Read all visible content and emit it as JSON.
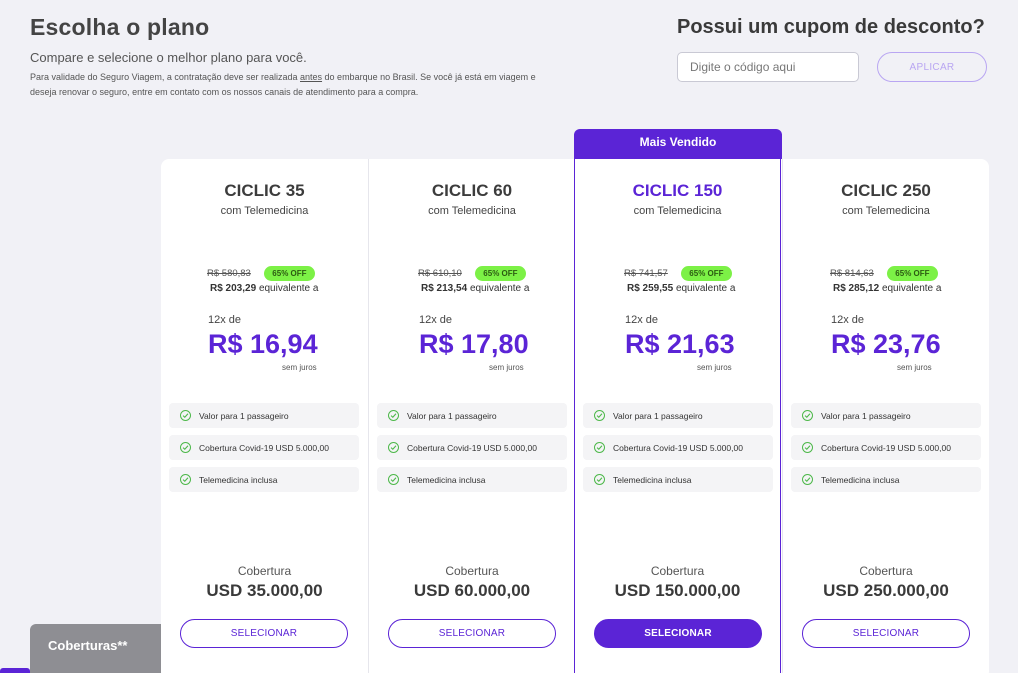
{
  "header": {
    "title": "Escolha o plano",
    "subtitle": "Compare e selecione o melhor plano para você.",
    "note_before": "Para validade do Seguro Viagem, a contratação deve ser realizada ",
    "note_emphasis": "antes",
    "note_after": " do embarque no Brasil. Se você já está em viagem e deseja renovar o seguro, entre em contato com os nossos canais de atendimento para a compra."
  },
  "coupon": {
    "title": "Possui um cupom de desconto?",
    "placeholder": "Digite o código aqui",
    "value": "",
    "apply_label": "APLICAR"
  },
  "featured_tag": "Mais Vendido",
  "plans": [
    {
      "name": "CICLIC 35",
      "subtitle": "com Telemedicina",
      "old_price": "R$ 580,83",
      "discount": "65% OFF",
      "total_price": "R$ 203,29",
      "equiv_text": "equivalente a",
      "installments": "12x de",
      "installment_price": "R$ 16,94",
      "interest": "sem juros",
      "features": [
        "Valor para 1 passageiro",
        "Cobertura Covid-19 USD 5.000,00",
        "Telemedicina inclusa"
      ],
      "coverage_label": "Cobertura",
      "coverage_value": "USD 35.000,00",
      "select_label": "SELECIONAR",
      "featured": false
    },
    {
      "name": "CICLIC 60",
      "subtitle": "com Telemedicina",
      "old_price": "R$ 610,10",
      "discount": "65% OFF",
      "total_price": "R$ 213,54",
      "equiv_text": "equivalente a",
      "installments": "12x de",
      "installment_price": "R$ 17,80",
      "interest": "sem juros",
      "features": [
        "Valor para 1 passageiro",
        "Cobertura Covid-19 USD 5.000,00",
        "Telemedicina inclusa"
      ],
      "coverage_label": "Cobertura",
      "coverage_value": "USD 60.000,00",
      "select_label": "SELECIONAR",
      "featured": false
    },
    {
      "name": "CICLIC 150",
      "subtitle": "com Telemedicina",
      "old_price": "R$ 741,57",
      "discount": "65% OFF",
      "total_price": "R$ 259,55",
      "equiv_text": "equivalente a",
      "installments": "12x de",
      "installment_price": "R$ 21,63",
      "interest": "sem juros",
      "features": [
        "Valor para 1 passageiro",
        "Cobertura Covid-19 USD 5.000,00",
        "Telemedicina inclusa"
      ],
      "coverage_label": "Cobertura",
      "coverage_value": "USD 150.000,00",
      "select_label": "SELECIONAR",
      "featured": true
    },
    {
      "name": "CICLIC 250",
      "subtitle": "com Telemedicina",
      "old_price": "R$ 814,63",
      "discount": "65% OFF",
      "total_price": "R$ 285,12",
      "equiv_text": "equivalente a",
      "installments": "12x de",
      "installment_price": "R$ 23,76",
      "interest": "sem juros",
      "features": [
        "Valor para 1 passageiro",
        "Cobertura Covid-19 USD 5.000,00",
        "Telemedicina inclusa"
      ],
      "coverage_label": "Cobertura",
      "coverage_value": "USD 250.000,00",
      "select_label": "SELECIONAR",
      "featured": false
    }
  ],
  "coverages_tab": "Coberturas**",
  "colors": {
    "brand": "#5b24d6",
    "discount_badge": "#7cf146",
    "check": "#4db84a",
    "page_background": "#f1f1f6"
  }
}
